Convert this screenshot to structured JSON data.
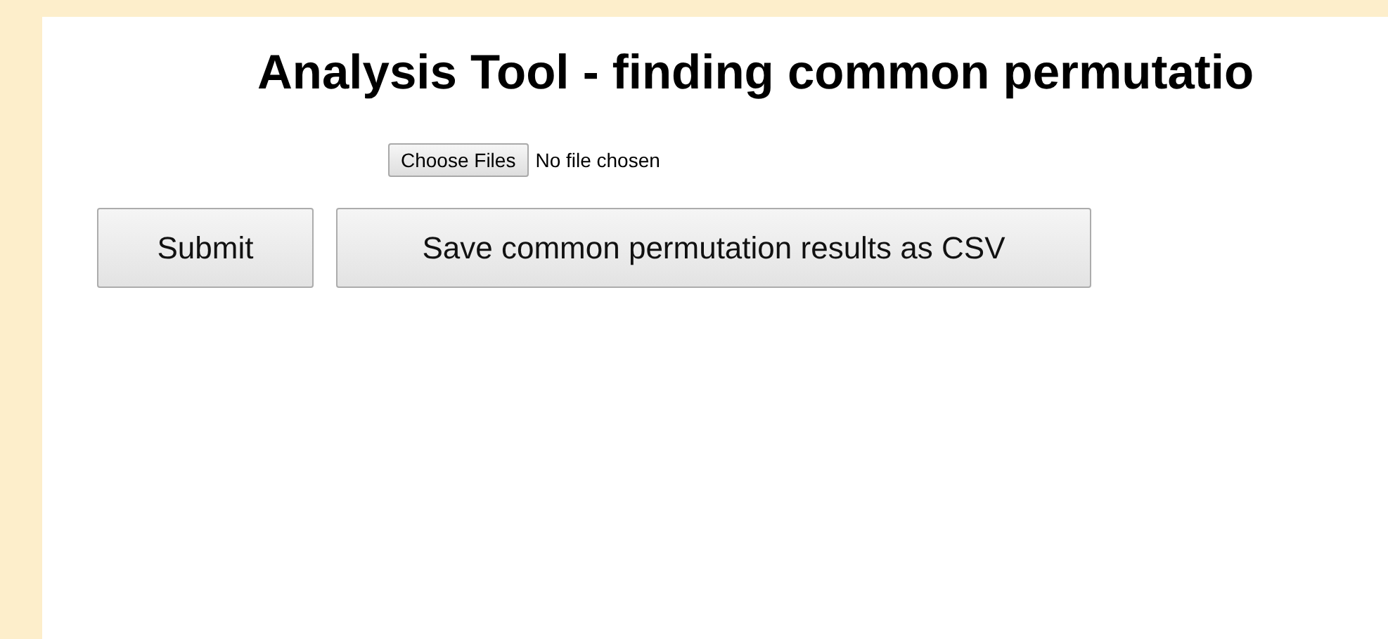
{
  "heading": "Analysis Tool - finding common permutatio",
  "file_input": {
    "button": "Choose Files",
    "status": "No file chosen"
  },
  "buttons": [
    "Submit",
    "Save common permutation results as CSV"
  ]
}
